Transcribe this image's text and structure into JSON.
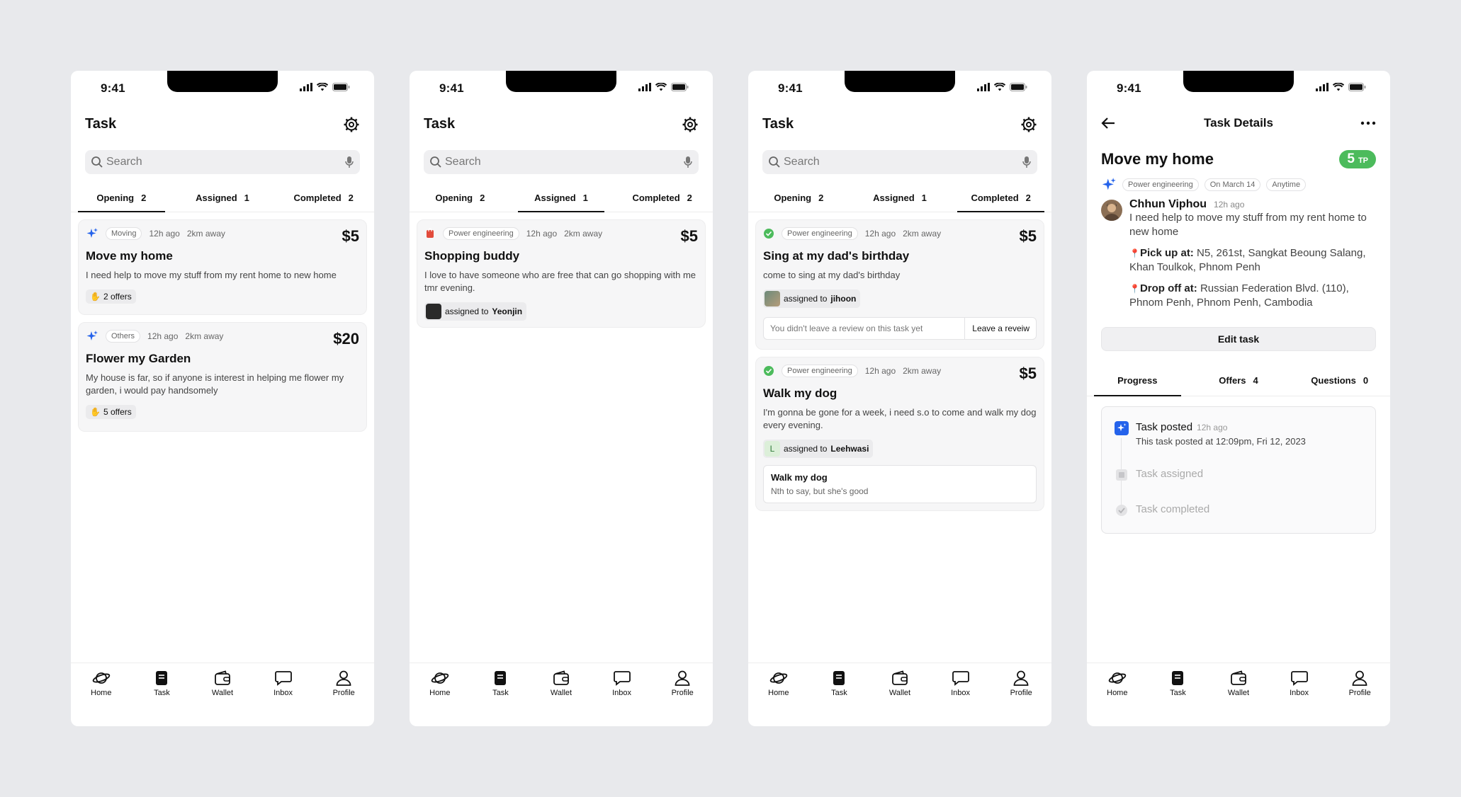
{
  "status": {
    "time": "9:41"
  },
  "list": {
    "title": "Task",
    "search_placeholder": "Search",
    "tabs": [
      {
        "label": "Opening",
        "count": "2"
      },
      {
        "label": "Assigned",
        "count": "1"
      },
      {
        "label": "Completed",
        "count": "2"
      }
    ]
  },
  "opening_tasks": [
    {
      "category": "Moving",
      "ago": "12h ago",
      "distance": "2km away",
      "price": "$5",
      "title": "Move my home",
      "desc": "I need help to move my stuff from my rent home to new home",
      "offers": "2 offers"
    },
    {
      "category": "Others",
      "ago": "12h ago",
      "distance": "2km away",
      "price": "$20",
      "title": "Flower my Garden",
      "desc": "My house is far, so if anyone is interest in helping me flower my garden, i would pay handsomely",
      "offers": "5 offers"
    }
  ],
  "assigned_tasks": [
    {
      "category": "Power engineering",
      "ago": "12h ago",
      "distance": "2km away",
      "price": "$5",
      "title": "Shopping buddy",
      "desc": "I love to have someone who are free that can go shopping with me tmr evening.",
      "assigned_prefix": "assigned to",
      "assignee": "Yeonjin"
    }
  ],
  "completed_tasks": [
    {
      "category": "Power engineering",
      "ago": "12h ago",
      "distance": "2km away",
      "price": "$5",
      "title": "Sing at my dad's birthday",
      "desc": "come to sing at my dad's birthday",
      "assigned_prefix": "assigned to",
      "assignee": "jihoon",
      "review_note": "You didn't leave a review on this task yet",
      "review_action": "Leave a reveiw"
    },
    {
      "category": "Power engineering",
      "ago": "12h ago",
      "distance": "2km away",
      "price": "$5",
      "title": "Walk my dog",
      "desc": "I'm gonna be gone for a week, i need s.o to come and walk my dog every evening.",
      "assigned_prefix": "assigned to",
      "assignee": "Leehwasi",
      "assignee_initial": "L",
      "review_title": "Walk my dog",
      "review_text": "Nth to say, but she's good"
    }
  ],
  "detail": {
    "header_title": "Task Details",
    "title": "Move my home",
    "points": "5",
    "points_unit": "TP",
    "chips": [
      "Power engineering",
      "On March 14",
      "Anytime"
    ],
    "author": "Chhun Viphou",
    "author_ago": "12h ago",
    "desc": "I need help to move my stuff from my rent home to new home",
    "pickup_label": "Pick up at:",
    "pickup": "N5, 261st, Sangkat Beoung Salang, Khan Toulkok, Phnom Penh",
    "dropoff_label": "Drop off at:",
    "dropoff": "Russian Federation Blvd. (110), Phnom Penh, Phnom Penh, Cambodia",
    "edit_label": "Edit task",
    "tabs": [
      {
        "label": "Progress",
        "count": ""
      },
      {
        "label": "Offers",
        "count": "4"
      },
      {
        "label": "Questions",
        "count": "0"
      }
    ],
    "steps": [
      {
        "name": "Task posted",
        "ago": "12h ago",
        "sub": "This task posted at 12:09pm, Fri 12, 2023"
      },
      {
        "name": "Task assigned"
      },
      {
        "name": "Task completed"
      }
    ]
  },
  "nav": [
    "Home",
    "Task",
    "Wallet",
    "Inbox",
    "Profile"
  ],
  "colors": {
    "accent_blue": "#2563eb",
    "points_green": "#4cbb5c",
    "completed_green": "#4cbb5c",
    "assigned_red": "#e24b3b"
  }
}
